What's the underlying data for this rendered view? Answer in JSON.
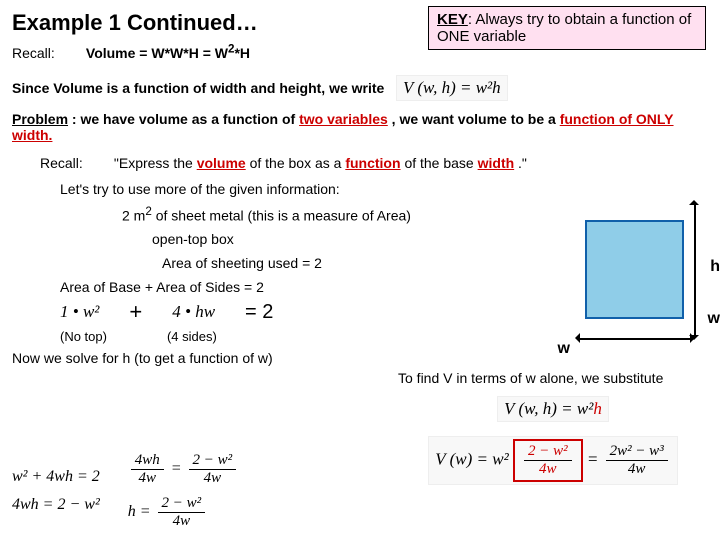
{
  "title": "Example 1 Continued…",
  "key": {
    "label": "KEY",
    "text": ": Always try to obtain a function of ONE variable"
  },
  "recall1": {
    "label": "Recall:",
    "text": "Volume = W*W*H = W",
    "sup": "2",
    "suffix": "*H"
  },
  "since": "Since Volume is a function of width and height, we write",
  "vwh": "V (w, h) = w²h",
  "problem": {
    "label": "Problem",
    "a": ": we have volume as a function of ",
    "b": "two variables",
    "c": ", we want volume to be a ",
    "d": "function of ONLY width."
  },
  "recall2": {
    "label": "Recall:",
    "q1": "\"Express the ",
    "vol": "volume",
    "q2": " of the box as a ",
    "func": "function",
    "q3": " of the base ",
    "width": "width",
    "end": ".\""
  },
  "lets": "Let's try to use more of the given information:",
  "sheet": {
    "a": "2 m",
    "sup": "2",
    "b": " of sheet metal (this is a measure of Area)"
  },
  "open": "open-top box",
  "area_eq": "Area of sheeting used = 2",
  "base_sides": "Area of Base + Area of Sides = 2",
  "term1": "1 • w²",
  "plus": "+",
  "term2": "4 • hw",
  "equals2": "= 2",
  "notop": "(No top)",
  "foursides": "(4 sides)",
  "solve_h": "Now we solve for h (to get a function of w)",
  "hlab": "h",
  "wlab": "w",
  "eq_b1": "w² + 4wh = 2",
  "eq_b2": "4wh = 2 − w²",
  "eq_b3_num": "4wh",
  "eq_b3_den": "4w",
  "eq_b3_rnum": "2 − w²",
  "eq_b3_rden": "4w",
  "eq_h_num": "2 − w²",
  "eq_h_den": "4w",
  "eq_h_lhs": "h =",
  "sub_text": "To find V in terms of w alone, we substitute",
  "v_sub_lhs": "V (w, h) = w²",
  "v_sub_h": "h",
  "v_final_lhs": "V (w) = w²",
  "v_final_frac_num": "2 − w²",
  "v_final_frac_den": "4w",
  "v_final_eq": "=",
  "v_final_rnum": "2w² − w³",
  "v_final_rden": "4w"
}
